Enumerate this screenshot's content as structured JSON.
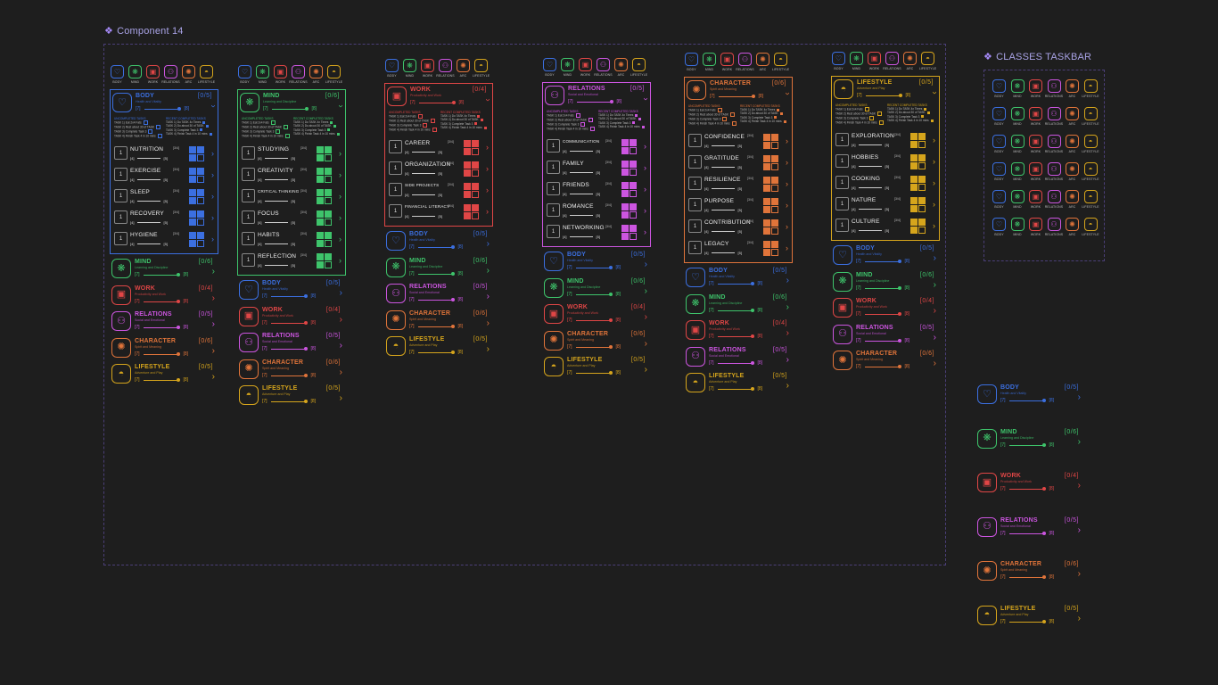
{
  "header": {
    "component_title": "Component 14",
    "taskbar_title": "CLASSES TASKBAR",
    "title_icon": "component-icon"
  },
  "categories": [
    {
      "key": "body",
      "name": "BODY",
      "tab_label": "BODY",
      "subtitle": "Health and Vitality",
      "count": "[0/5]",
      "level_a": "[7]",
      "level_b": "[8]",
      "color": "#3b6fe0",
      "icon": "heart-icon",
      "glyph": "♡"
    },
    {
      "key": "mind",
      "name": "MIND",
      "tab_label": "MIND",
      "subtitle": "Learning and Discipline",
      "count": "[0/6]",
      "level_a": "[7]",
      "level_b": "[8]",
      "color": "#3ec46b",
      "icon": "brain-icon",
      "glyph": "❋"
    },
    {
      "key": "work",
      "name": "WORK",
      "tab_label": "WORK",
      "subtitle": "Productivity and Work",
      "count": "[0/4]",
      "level_a": "[7]",
      "level_b": "[8]",
      "color": "#e04646",
      "icon": "briefcase-icon",
      "glyph": "▣"
    },
    {
      "key": "relations",
      "name": "RELATIONS",
      "tab_label": "RELATIONS",
      "subtitle": "Social and Emotional",
      "count": "[0/5]",
      "level_a": "[7]",
      "level_b": "[8]",
      "color": "#cc55e0",
      "icon": "people-icon",
      "glyph": "⚇"
    },
    {
      "key": "character",
      "name": "CHARACTER",
      "tab_label": "ARC",
      "subtitle": "Spirit and Meaning",
      "count": "[0/6]",
      "level_a": "[7]",
      "level_b": "[8]",
      "color": "#e0743a",
      "icon": "compass-icon",
      "glyph": "✺"
    },
    {
      "key": "lifestyle",
      "name": "LIFESTYLE",
      "tab_label": "LIFESTYLE",
      "subtitle": "Adventure and Play",
      "count": "[0/5]",
      "level_a": "[7]",
      "level_b": "[8]",
      "color": "#d6a51c",
      "icon": "hat-icon",
      "glyph": "◓"
    }
  ],
  "tasks": {
    "uncompleted_header": "UNCOMPLETED TASKS",
    "completed_header": "RECENT COMPLETED TASKS",
    "count_label": "0/4",
    "uncompleted": [
      "TASK 1) Eat 2x4 Fats",
      "TASK 2) Rest about 30 of TASK",
      "TASK 3) Complete Task 3",
      "TASK 4) Finish Task 4 in 10 mins"
    ],
    "completed": [
      "TASK 1) Do TASK 4x Times",
      "TASK 2) Do about 30 of TASK",
      "TASK 3) Complete Task 3",
      "TASK 4) Finish Task 4 in 10 mins"
    ]
  },
  "subitems": {
    "body": [
      {
        "name": "NUTRITION",
        "count": "[3/4]",
        "a": "[4]",
        "b": "[5]"
      },
      {
        "name": "EXERCISE",
        "count": "[3/4]",
        "a": "[4]",
        "b": "[5]"
      },
      {
        "name": "SLEEP",
        "count": "[3/4]",
        "a": "[4]",
        "b": "[5]"
      },
      {
        "name": "RECOVERY",
        "count": "[3/4]",
        "a": "[4]",
        "b": "[5]"
      },
      {
        "name": "HYGIENE",
        "count": "[3/4]",
        "a": "[4]",
        "b": "[5]"
      }
    ],
    "mind": [
      {
        "name": "STUDYING",
        "count": "[3/4]",
        "a": "[4]",
        "b": "[5]"
      },
      {
        "name": "CREATIVITY",
        "count": "[3/4]",
        "a": "[4]",
        "b": "[5]"
      },
      {
        "name": "CRITICAL THINKING",
        "count": "[3/4]",
        "a": "[4]",
        "b": "[5]"
      },
      {
        "name": "FOCUS",
        "count": "[3/4]",
        "a": "[4]",
        "b": "[5]"
      },
      {
        "name": "HABITS",
        "count": "[3/4]",
        "a": "[4]",
        "b": "[5]"
      },
      {
        "name": "REFLECTION",
        "count": "[3/4]",
        "a": "[4]",
        "b": "[5]"
      }
    ],
    "work": [
      {
        "name": "CAREER",
        "count": "[3/4]",
        "a": "[4]",
        "b": "[5]"
      },
      {
        "name": "ORGANIZATION",
        "count": "[3/4]",
        "a": "[4]",
        "b": "[5]"
      },
      {
        "name": "SIDE PROJECTS",
        "count": "[3/4]",
        "a": "[4]",
        "b": "[5]"
      },
      {
        "name": "FINANCIAL LITERACY",
        "count": "[3/4]",
        "a": "[4]",
        "b": "[5]"
      }
    ],
    "relations": [
      {
        "name": "COMMUNICATION",
        "count": "[3/4]",
        "a": "[4]",
        "b": "[5]"
      },
      {
        "name": "FAMILY",
        "count": "[3/4]",
        "a": "[4]",
        "b": "[5]"
      },
      {
        "name": "FRIENDS",
        "count": "[3/4]",
        "a": "[4]",
        "b": "[5]"
      },
      {
        "name": "ROMANCE",
        "count": "[3/4]",
        "a": "[4]",
        "b": "[5]"
      },
      {
        "name": "NETWORKING",
        "count": "[3/4]",
        "a": "[4]",
        "b": "[5]"
      }
    ],
    "character": [
      {
        "name": "CONFIDENCE",
        "count": "[3/4]",
        "a": "[4]",
        "b": "[5]"
      },
      {
        "name": "GRATITUDE",
        "count": "[3/4]",
        "a": "[4]",
        "b": "[5]"
      },
      {
        "name": "RESILIENCE",
        "count": "[3/4]",
        "a": "[4]",
        "b": "[5]"
      },
      {
        "name": "PURPOSE",
        "count": "[3/4]",
        "a": "[4]",
        "b": "[5]"
      },
      {
        "name": "CONTRIBUTION",
        "count": "[3/4]",
        "a": "[4]",
        "b": "[5]"
      },
      {
        "name": "LEGACY",
        "count": "[3/4]",
        "a": "[4]",
        "b": "[5]"
      }
    ],
    "lifestyle": [
      {
        "name": "EXPLORATION",
        "count": "[3/4]",
        "a": "[4]",
        "b": "[5]"
      },
      {
        "name": "HOBBIES",
        "count": "[3/4]",
        "a": "[4]",
        "b": "[5]"
      },
      {
        "name": "COOKING",
        "count": "[3/4]",
        "a": "[4]",
        "b": "[5]"
      },
      {
        "name": "NATURE",
        "count": "[3/4]",
        "a": "[4]",
        "b": "[5]"
      },
      {
        "name": "CULTURE",
        "count": "[3/4]",
        "a": "[4]",
        "b": "[5]"
      }
    ]
  },
  "colors": {
    "background": "#1e1e1e",
    "frame_border": "#4b3f78",
    "title": "#a9a3e6"
  }
}
